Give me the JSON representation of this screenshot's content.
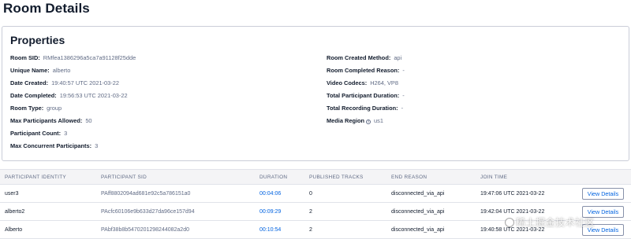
{
  "page": {
    "title": "Room Details"
  },
  "properties": {
    "heading": "Properties",
    "left": [
      {
        "label": "Room SID:",
        "value": "RMfea1386296a5ca7a91128f25dde"
      },
      {
        "label": "Unique Name:",
        "value": "alberto"
      },
      {
        "label": "Date Created:",
        "value": "19:40:57 UTC 2021-03-22"
      },
      {
        "label": "Date Completed:",
        "value": "19:56:53 UTC 2021-03-22"
      },
      {
        "label": "Room Type:",
        "value": "group"
      },
      {
        "label": "Max Participants Allowed:",
        "value": "50"
      },
      {
        "label": "Participant Count:",
        "value": "3"
      },
      {
        "label": "Max Concurrent Participants:",
        "value": "3"
      }
    ],
    "right": [
      {
        "label": "Room Created Method:",
        "value": "api"
      },
      {
        "label": "Room Completed Reason:",
        "value": "-"
      },
      {
        "label": "Video Codecs:",
        "value": "H264, VP8"
      },
      {
        "label": "Total Participant Duration:",
        "value": "-"
      },
      {
        "label": "Total Recording Duration:",
        "value": "-"
      },
      {
        "label": "Media Region",
        "value": "us1",
        "icon": "info-icon"
      }
    ]
  },
  "participants": {
    "columns": [
      "PARTICIPANT IDENTITY",
      "PARTICIPANT SID",
      "DURATION",
      "PUBLISHED TRACKS",
      "END REASON",
      "JOIN TIME"
    ],
    "rows": [
      {
        "identity": "user3",
        "sid": "PAff8802094ad681e92c5a786151a0",
        "duration": "00:04:06",
        "tracks": "0",
        "end_reason": "disconnected_via_api",
        "join_time": "19:47:06 UTC 2021-03-22",
        "action": "View Details"
      },
      {
        "identity": "alberto2",
        "sid": "PAcfc60106e9b633d27da96ce157d94",
        "duration": "00:09:29",
        "tracks": "2",
        "end_reason": "disconnected_via_api",
        "join_time": "19:42:04 UTC 2021-03-22",
        "action": "View Details"
      },
      {
        "identity": "Alberto",
        "sid": "PAbf38b8b5470201298244082a2d0",
        "duration": "00:10:54",
        "tracks": "2",
        "end_reason": "disconnected_via_api",
        "join_time": "19:40:58 UTC 2021-03-22",
        "action": "View Details"
      }
    ]
  },
  "watermark": {
    "text": "稀土掘金技术社区",
    "icon": "juejin-logo-icon"
  },
  "colors": {
    "link": "#0263e0",
    "text": "#121c2d",
    "muted": "#606b85",
    "border": "#cacdd8",
    "header_bg": "#f4f4f6"
  }
}
